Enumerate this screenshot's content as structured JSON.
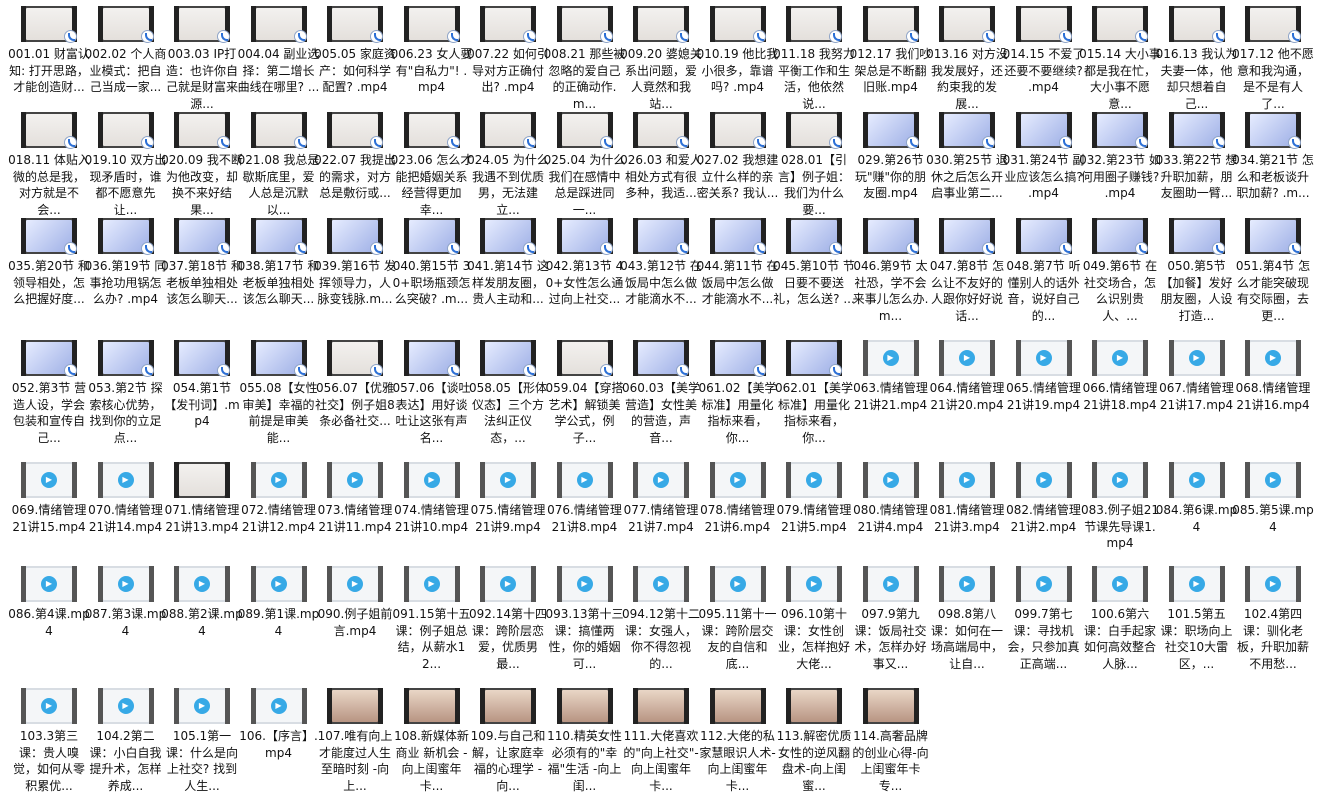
{
  "window": {
    "type": "file-explorer-large-icon-view"
  },
  "files": [
    {
      "name": "001.01 财富认知: 打开思路，才能创造财...",
      "thumb": "pale",
      "badge": true
    },
    {
      "name": "002.02 个人商业模式：把自己当成一家...",
      "thumb": "pale",
      "badge": true
    },
    {
      "name": "003.03 IP打造：也许你自己就是财富来源...",
      "thumb": "pale",
      "badge": true
    },
    {
      "name": "004.04 副业选择：第二增长曲线在哪里? ...",
      "thumb": "pale",
      "badge": true
    },
    {
      "name": "005.05 家庭资产：如何科学配置? .mp4",
      "thumb": "pale",
      "badge": true
    },
    {
      "name": "006.23 女人要有\"自私力\"! .mp4",
      "thumb": "pale",
      "badge": true
    },
    {
      "name": "007.22 如何引导对方正确付出? .mp4",
      "thumb": "pale",
      "badge": true
    },
    {
      "name": "008.21 那些被忽略的爱自己的正确动作.m...",
      "thumb": "pale",
      "badge": true
    },
    {
      "name": "009.20 婆媳关系出问题，爱人竟然和我站...",
      "thumb": "pale",
      "badge": true
    },
    {
      "name": "010.19 他比我小很多，靠谱吗? .mp4",
      "thumb": "pale",
      "badge": true
    },
    {
      "name": "011.18 我努力平衡工作和生活，他依然说...",
      "thumb": "pale",
      "badge": true
    },
    {
      "name": "012.17 我们吵架总是不断翻旧账.mp4",
      "thumb": "pale",
      "badge": true
    },
    {
      "name": "013.16 对方没我发展好，还約束我的发展...",
      "thumb": "pale",
      "badge": true
    },
    {
      "name": "014.15 不爱了还要不要继续? .mp4",
      "thumb": "pale",
      "badge": true
    },
    {
      "name": "015.14 大小事都是我在忙，大小事不愿意...",
      "thumb": "pale",
      "badge": true
    },
    {
      "name": "016.13 我认为夫妻一体，他却只想着自己...",
      "thumb": "pale",
      "badge": true
    },
    {
      "name": "017.12 他不愿意和我沟通，是不是有人了...",
      "thumb": "pale",
      "badge": true
    },
    {
      "name": "018.11 体贴入微的总是我，对方就是不会...",
      "thumb": "pale",
      "badge": true
    },
    {
      "name": "019.10 双方出现矛盾时，谁都不愿意先让...",
      "thumb": "pale",
      "badge": true
    },
    {
      "name": "020.09 我不断为他改变，却换不来好结果...",
      "thumb": "pale",
      "badge": true
    },
    {
      "name": "021.08 我总是歇斯底里，爱人总是沉默以...",
      "thumb": "pale",
      "badge": true
    },
    {
      "name": "022.07 我提出的需求，对方总是敷衍或...",
      "thumb": "pale",
      "badge": true
    },
    {
      "name": "023.06 怎么才能把婚姻关系经营得更加幸...",
      "thumb": "pale",
      "badge": true
    },
    {
      "name": "024.05 为什么我遇不到优质男，无法建立...",
      "thumb": "pale",
      "badge": true
    },
    {
      "name": "025.04 为什么我们在感情中总是踩进同一...",
      "thumb": "pale",
      "badge": true
    },
    {
      "name": "026.03 和爱人相处方式有很多种，我适...",
      "thumb": "pale",
      "badge": true
    },
    {
      "name": "027.02 我想建立什么样的亲密关系? 我认...",
      "thumb": "pale",
      "badge": true
    },
    {
      "name": "028.01【引言】例子姐：我们为什么要...",
      "thumb": "pale",
      "badge": true
    },
    {
      "name": "029.第26节 玩\"赚\"你的朋友圈.mp4",
      "thumb": "blue",
      "badge": true
    },
    {
      "name": "030.第25节 退休之后怎么开启事业第二...",
      "thumb": "blue",
      "badge": true
    },
    {
      "name": "031.第24节 副业应该怎么搞? .mp4",
      "thumb": "blue",
      "badge": true
    },
    {
      "name": "032.第23节 如何用圈子赚钱? .mp4",
      "thumb": "blue",
      "badge": true
    },
    {
      "name": "033.第22节 想升职加薪，朋友圈助一臂...",
      "thumb": "blue",
      "badge": true
    },
    {
      "name": "034.第21节 怎么和老板谈升职加薪? .m...",
      "thumb": "blue",
      "badge": true
    },
    {
      "name": "035.第20节 和领导相处，怎么把握好度...",
      "thumb": "blue",
      "badge": true
    },
    {
      "name": "036.第19节 同事抢功甩锅怎么办? .mp4",
      "thumb": "blue",
      "badge": true
    },
    {
      "name": "037.第18节 和老板单独相处该怎么聊天...",
      "thumb": "blue",
      "badge": true
    },
    {
      "name": "038.第17节 和老板单独相处该怎么聊天...",
      "thumb": "blue",
      "badge": true
    },
    {
      "name": "039.第16节 发挥领导力，人脉变钱脉.m...",
      "thumb": "blue",
      "badge": true
    },
    {
      "name": "040.第15节 30+职场瓶颈怎么突破? .m...",
      "thumb": "blue",
      "badge": true
    },
    {
      "name": "041.第14节 这样发朋友圈，贵人主动和...",
      "thumb": "blue",
      "badge": true
    },
    {
      "name": "042.第13节 40+女性怎么通过向上社交...",
      "thumb": "blue",
      "badge": true
    },
    {
      "name": "043.第12节 在饭局中怎么做才能滴水不...",
      "thumb": "blue",
      "badge": true
    },
    {
      "name": "044.第11节 在饭局中怎么做才能滴水不...",
      "thumb": "blue",
      "badge": true
    },
    {
      "name": "045.第10节 节日要不要送礼，怎么送? ...",
      "thumb": "blue",
      "badge": true
    },
    {
      "name": "046.第9节 太社恐，学不会来事儿怎么办.m...",
      "thumb": "blue",
      "badge": true
    },
    {
      "name": "047.第8节 怎么让不友好的人跟你好好说话...",
      "thumb": "blue",
      "badge": true
    },
    {
      "name": "048.第7节 听懂别人的话外音，说好自己的...",
      "thumb": "blue",
      "badge": true
    },
    {
      "name": "049.第6节 在社交场合，怎么识别贵人、...",
      "thumb": "blue",
      "badge": true
    },
    {
      "name": "050.第5节【加餐】发好朋友圈，人设打造...",
      "thumb": "blue",
      "badge": true
    },
    {
      "name": "051.第4节 怎么才能突破现有交际圈，去更...",
      "thumb": "blue",
      "badge": true
    },
    {
      "name": "052.第3节 营造人设，学会包装和宣传自己...",
      "thumb": "blue",
      "badge": true
    },
    {
      "name": "053.第2节 探索核心优势，找到你的立足点...",
      "thumb": "blue",
      "badge": true
    },
    {
      "name": "054.第1节【发刊词】.mp4",
      "thumb": "blue",
      "badge": true
    },
    {
      "name": "055.08【女性审美】幸福的前提是审美能...",
      "thumb": "blue",
      "badge": true
    },
    {
      "name": "056.07【优雅社交】例子姐8条必备社交...",
      "thumb": "pale",
      "badge": true
    },
    {
      "name": "057.06【谈吐表达】用好谈吐让这张有声名...",
      "thumb": "blue",
      "badge": true
    },
    {
      "name": "058.05【形体仪态】三个方法纠正仪态，...",
      "thumb": "blue",
      "badge": true
    },
    {
      "name": "059.04【穿搭艺术】解锁美学公式，例子...",
      "thumb": "pale",
      "badge": true
    },
    {
      "name": "060.03【美学营造】女性美的营造，声音...",
      "thumb": "blue",
      "badge": true
    },
    {
      "name": "061.02【美学标准】用量化指标来看，你...",
      "thumb": "blue",
      "badge": true
    },
    {
      "name": "062.01【美学标准】用量化指标来看，你...",
      "thumb": "blue",
      "badge": true
    },
    {
      "name": "063.情绪管理21讲21.mp4",
      "thumb": "generic",
      "badge": false
    },
    {
      "name": "064.情绪管理21讲20.mp4",
      "thumb": "generic",
      "badge": false
    },
    {
      "name": "065.情绪管理21讲19.mp4",
      "thumb": "generic",
      "badge": false
    },
    {
      "name": "066.情绪管理21讲18.mp4",
      "thumb": "generic",
      "badge": false
    },
    {
      "name": "067.情绪管理21讲17.mp4",
      "thumb": "generic",
      "badge": false
    },
    {
      "name": "068.情绪管理21讲16.mp4",
      "thumb": "generic",
      "badge": false
    },
    {
      "name": "069.情绪管理21讲15.mp4",
      "thumb": "generic",
      "badge": false
    },
    {
      "name": "070.情绪管理21讲14.mp4",
      "thumb": "generic",
      "badge": false
    },
    {
      "name": "071.情绪管理21讲13.mp4",
      "thumb": "pale",
      "badge": false
    },
    {
      "name": "072.情绪管理21讲12.mp4",
      "thumb": "generic",
      "badge": false
    },
    {
      "name": "073.情绪管理21讲11.mp4",
      "thumb": "generic",
      "badge": false
    },
    {
      "name": "074.情绪管理21讲10.mp4",
      "thumb": "generic",
      "badge": false
    },
    {
      "name": "075.情绪管理21讲9.mp4",
      "thumb": "generic",
      "badge": false
    },
    {
      "name": "076.情绪管理21讲8.mp4",
      "thumb": "generic",
      "badge": false
    },
    {
      "name": "077.情绪管理21讲7.mp4",
      "thumb": "generic",
      "badge": false
    },
    {
      "name": "078.情绪管理21讲6.mp4",
      "thumb": "generic",
      "badge": false
    },
    {
      "name": "079.情绪管理21讲5.mp4",
      "thumb": "generic",
      "badge": false
    },
    {
      "name": "080.情绪管理21讲4.mp4",
      "thumb": "generic",
      "badge": false
    },
    {
      "name": "081.情绪管理21讲3.mp4",
      "thumb": "generic",
      "badge": false
    },
    {
      "name": "082.情绪管理21讲2.mp4",
      "thumb": "generic",
      "badge": false
    },
    {
      "name": "083.例子姐21节课先导课1.mp4",
      "thumb": "generic",
      "badge": false
    },
    {
      "name": "084.第6课.mp4",
      "thumb": "generic",
      "badge": false
    },
    {
      "name": "085.第5课.mp4",
      "thumb": "generic",
      "badge": false
    },
    {
      "name": "086.第4课.mp4",
      "thumb": "generic",
      "badge": false
    },
    {
      "name": "087.第3课.mp4",
      "thumb": "generic",
      "badge": false
    },
    {
      "name": "088.第2课.mp4",
      "thumb": "generic",
      "badge": false
    },
    {
      "name": "089.第1课.mp4",
      "thumb": "generic",
      "badge": false
    },
    {
      "name": "090.例子姐前言.mp4",
      "thumb": "generic",
      "badge": false
    },
    {
      "name": "091.15第十五课：例子姐总结，从薪水12...",
      "thumb": "generic",
      "badge": false
    },
    {
      "name": "092.14第十四课：跨阶层恋爱，优质男最...",
      "thumb": "generic",
      "badge": false
    },
    {
      "name": "093.13第十三课：搞懂两性，你的婚姻可...",
      "thumb": "generic",
      "badge": false
    },
    {
      "name": "094.12第十二课：女强人，你不得忽视的...",
      "thumb": "generic",
      "badge": false
    },
    {
      "name": "095.11第十一课：跨阶层交友的自信和底...",
      "thumb": "generic",
      "badge": false
    },
    {
      "name": "096.10第十课：女性创业，怎样抱好大佬...",
      "thumb": "generic",
      "badge": false
    },
    {
      "name": "097.9第九课：饭局社交术，怎样办好事又...",
      "thumb": "generic",
      "badge": false
    },
    {
      "name": "098.8第八课：如何在一场高端局中，让自...",
      "thumb": "generic",
      "badge": false
    },
    {
      "name": "099.7第七课：寻找机会，只参加真正高端...",
      "thumb": "generic",
      "badge": false
    },
    {
      "name": "100.6第六课：白手起家如何高效整合人脉...",
      "thumb": "generic",
      "badge": false
    },
    {
      "name": "101.5第五课：职场向上社交10大雷区，...",
      "thumb": "generic",
      "badge": false
    },
    {
      "name": "102.4第四课：驯化老板，升职加薪不用愁...",
      "thumb": "generic",
      "badge": false
    },
    {
      "name": "103.3第三课：贵人嗅觉，如何从零积累优...",
      "thumb": "generic",
      "badge": false
    },
    {
      "name": "104.2第二课：小白自我提升术，怎样养成...",
      "thumb": "generic",
      "badge": false
    },
    {
      "name": "105.1第一课：什么是向上社交? 找到人生...",
      "thumb": "generic",
      "badge": false
    },
    {
      "name": "106.【序言】.mp4",
      "thumb": "generic",
      "badge": false
    },
    {
      "name": "107.唯有向上才能度过人生至暗时刻 -向上...",
      "thumb": "photo",
      "badge": false
    },
    {
      "name": "108.新媒体新商业 新机会 -向上闺蜜年卡...",
      "thumb": "photo",
      "badge": false
    },
    {
      "name": "109.与自己和解，让家庭幸福的心理学 -向...",
      "thumb": "photo",
      "badge": false
    },
    {
      "name": "110.精英女性必须有的\"幸福\"生活 -向上闺...",
      "thumb": "photo",
      "badge": false
    },
    {
      "name": "111.大佬喜欢的\"向上社交\"-向上闺蜜年卡...",
      "thumb": "photo",
      "badge": false
    },
    {
      "name": "112.大佬的私家慧眼识人术-向上闺蜜年卡...",
      "thumb": "photo",
      "badge": false
    },
    {
      "name": "113.解密优质女性的逆风翻盘术-向上闺蜜...",
      "thumb": "photo",
      "badge": false
    },
    {
      "name": "114.高奢品牌的创业心得-向上闺蜜年卡专...",
      "thumb": "photo",
      "badge": false
    }
  ]
}
